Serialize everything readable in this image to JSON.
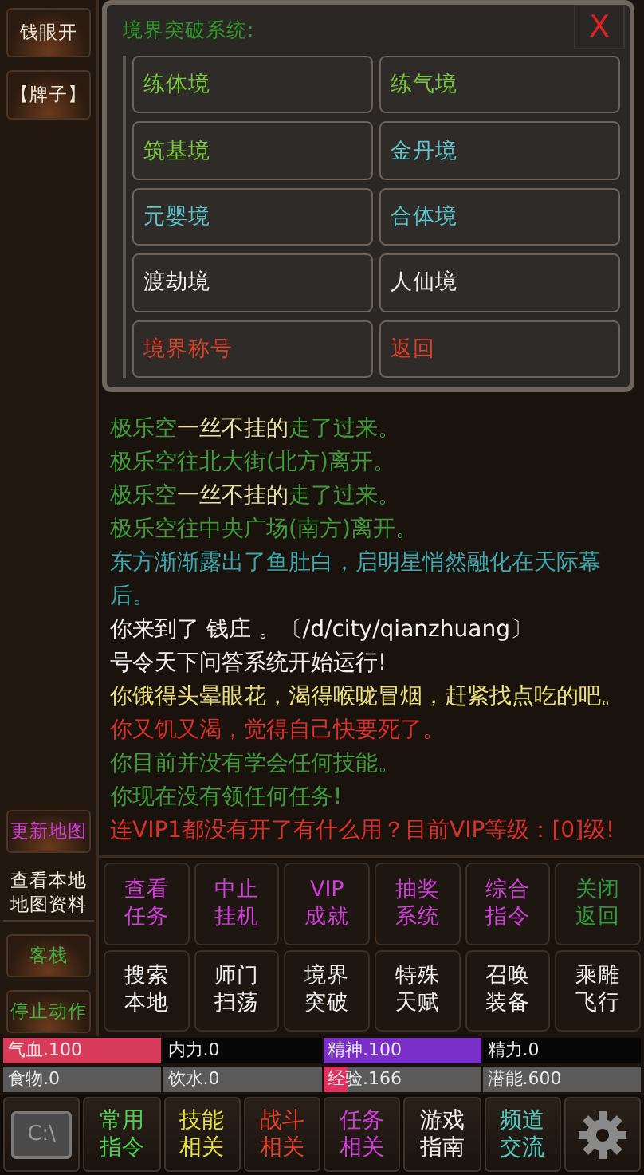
{
  "sidebar": {
    "top_buttons": [
      {
        "label": "钱眼开",
        "color": "#f0e8d8"
      },
      {
        "label": "【牌子】",
        "color": "#f0e8d8"
      }
    ],
    "bottom_buttons": [
      {
        "label": "更新地图",
        "color": "#d040d8",
        "kind": "button"
      },
      {
        "label": "查看本地地图资料",
        "color": "#f0e8d8",
        "kind": "plain"
      },
      {
        "label": "客栈",
        "color": "#3fb040",
        "kind": "button"
      },
      {
        "label": "停止动作",
        "color": "#3fb040",
        "kind": "button"
      }
    ]
  },
  "dialog": {
    "title": "境界突破系统:",
    "close": "X",
    "options": [
      {
        "label": "练体境",
        "color": "#78c83c"
      },
      {
        "label": "练气境",
        "color": "#78c83c"
      },
      {
        "label": "筑基境",
        "color": "#78c83c"
      },
      {
        "label": "金丹境",
        "color": "#5cc4cc"
      },
      {
        "label": "元婴境",
        "color": "#5cc4cc"
      },
      {
        "label": "合体境",
        "color": "#5cc4cc"
      },
      {
        "label": "渡劫境",
        "color": "#f0f0f0"
      },
      {
        "label": "人仙境",
        "color": "#f0f0f0"
      },
      {
        "label": "境界称号",
        "color": "#d8402a"
      },
      {
        "label": "返回",
        "color": "#d8402a"
      }
    ]
  },
  "log": [
    {
      "parts": [
        {
          "text": "极乐空",
          "color": "#3f9a3a"
        },
        {
          "text": "一丝不挂的",
          "color": "#e8e0a8"
        },
        {
          "text": "走了过来。",
          "color": "#3f9a3a"
        }
      ]
    },
    {
      "parts": [
        {
          "text": "极乐空往北大街(北方)离开。",
          "color": "#3f9a3a"
        }
      ]
    },
    {
      "parts": [
        {
          "text": "极乐空",
          "color": "#3f9a3a"
        },
        {
          "text": "一丝不挂的",
          "color": "#e8e0a8"
        },
        {
          "text": "走了过来。",
          "color": "#3f9a3a"
        }
      ]
    },
    {
      "parts": [
        {
          "text": "极乐空往中央广场(南方)离开。",
          "color": "#3f9a3a"
        }
      ]
    },
    {
      "parts": [
        {
          "text": "东方渐渐露出了鱼肚白，启明星悄然融化在天际幕后。",
          "color": "#3aa8b0"
        }
      ]
    },
    {
      "parts": [
        {
          "text": "你来到了 钱庄 。〔/d/city/qianzhuang〕",
          "color": "#f0f0f0"
        }
      ]
    },
    {
      "parts": [
        {
          "text": "号令天下问答系统开始运行!",
          "color": "#f0f0f0"
        }
      ]
    },
    {
      "parts": [
        {
          "text": "你饿得头晕眼花，渴得喉咙冒烟，赶紧找点吃的吧。",
          "color": "#ece078"
        }
      ]
    },
    {
      "parts": [
        {
          "text": "你又饥又渴，觉得自己快要死了。",
          "color": "#d8302a"
        }
      ]
    },
    {
      "parts": [
        {
          "text": "你目前并没有学会任何技能。",
          "color": "#3f9a3a"
        }
      ]
    },
    {
      "parts": [
        {
          "text": "你现在没有领任何任务!",
          "color": "#3f9a3a"
        }
      ]
    },
    {
      "parts": [
        {
          "text": "连VIP1都没有开了有什么用？目前VIP等级：[0]级!",
          "color": "#d8302a"
        }
      ]
    }
  ],
  "commands": [
    {
      "label": "查看任务",
      "color": "#d040d8"
    },
    {
      "label": "中止挂机",
      "color": "#d040d8"
    },
    {
      "label": "VIP成就",
      "color": "#d040d8"
    },
    {
      "label": "抽奖系统",
      "color": "#d040d8"
    },
    {
      "label": "综合指令",
      "color": "#d040d8"
    },
    {
      "label": "关闭返回",
      "color": "#2f9a3a"
    },
    {
      "label": "搜索本地",
      "color": "#f0f0f0"
    },
    {
      "label": "师门扫荡",
      "color": "#f0f0f0"
    },
    {
      "label": "境界突破",
      "color": "#f0f0f0"
    },
    {
      "label": "特殊天赋",
      "color": "#f0f0f0"
    },
    {
      "label": "召唤装备",
      "color": "#f0f0f0"
    },
    {
      "label": "乘雕飞行",
      "color": "#f0f0f0"
    }
  ],
  "stats": [
    {
      "kind": "vital",
      "bars": [
        {
          "label": "气血.100",
          "level": 1,
          "color": "#d83a5a"
        },
        {
          "label": "内力.0"
        },
        {
          "label": "精神.100",
          "level": 1,
          "color": "#7a30c8"
        },
        {
          "label": "精力.0"
        }
      ]
    },
    {
      "kind": "supply",
      "bars": [
        {
          "label": "食物.0"
        },
        {
          "label": "饮水.0"
        },
        {
          "label": "经验.166",
          "level": 0.16,
          "color": "#e03060"
        },
        {
          "label": "潜能.600"
        }
      ]
    }
  ],
  "bottom_bar": {
    "console_label": "C:\\",
    "tabs": [
      {
        "label": "常用指令",
        "color": "#50d050"
      },
      {
        "label": "技能相关",
        "color": "#e8e040"
      },
      {
        "label": "战斗相关",
        "color": "#e04028"
      },
      {
        "label": "任务相关",
        "color": "#d040d8"
      },
      {
        "label": "游戏指南",
        "color": "#f0f0f0"
      },
      {
        "label": "频道交流",
        "color": "#50c8c0"
      }
    ]
  }
}
